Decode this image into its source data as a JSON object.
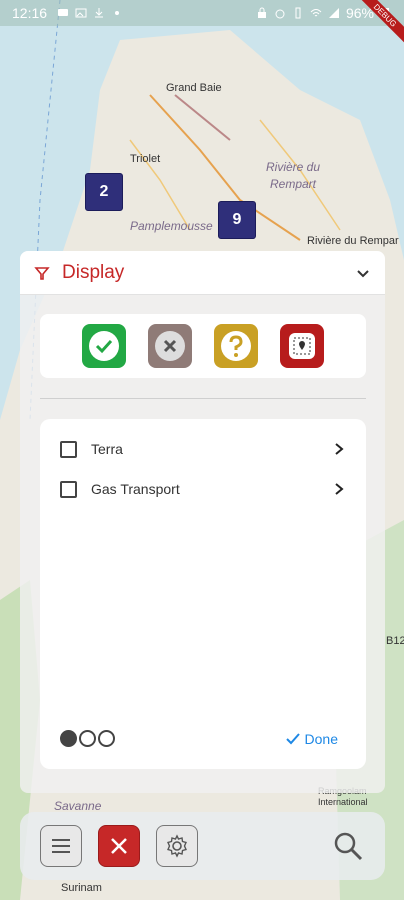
{
  "status_bar": {
    "time": "12:16",
    "battery": "96%",
    "debug_label": "DEBUG"
  },
  "map": {
    "labels": {
      "grand_baie": "Grand Baie",
      "triolet": "Triolet",
      "riviere_du_rempart": "Rivière du",
      "riviere_du_rempart_2": "Rempart",
      "pamplemousses": "Pamplemousse",
      "riviere_du_rempart_town": "Rivière du Rempar",
      "savanne": "Savanne",
      "surinam": "Surinam",
      "b12": "B12",
      "ramgoolam": "Ramgoolam",
      "international": "International"
    },
    "clusters": {
      "c2": "2",
      "c9": "9"
    }
  },
  "panel": {
    "title": "Display",
    "status_buttons": [
      {
        "name": "approved",
        "color": "#22a844"
      },
      {
        "name": "rejected",
        "color": "#8f7b77"
      },
      {
        "name": "unknown",
        "color": "#c9a024"
      },
      {
        "name": "location",
        "color": "#b71c1c"
      }
    ],
    "list_items": [
      {
        "label": "Terra",
        "checked": false
      },
      {
        "label": "Gas Transport",
        "checked": false
      }
    ],
    "pager": {
      "current": 1,
      "total": 3
    },
    "done_label": "Done"
  },
  "colors": {
    "accent_red": "#c62828",
    "accent_blue": "#1e88e5",
    "cluster": "#2f2f7a"
  }
}
